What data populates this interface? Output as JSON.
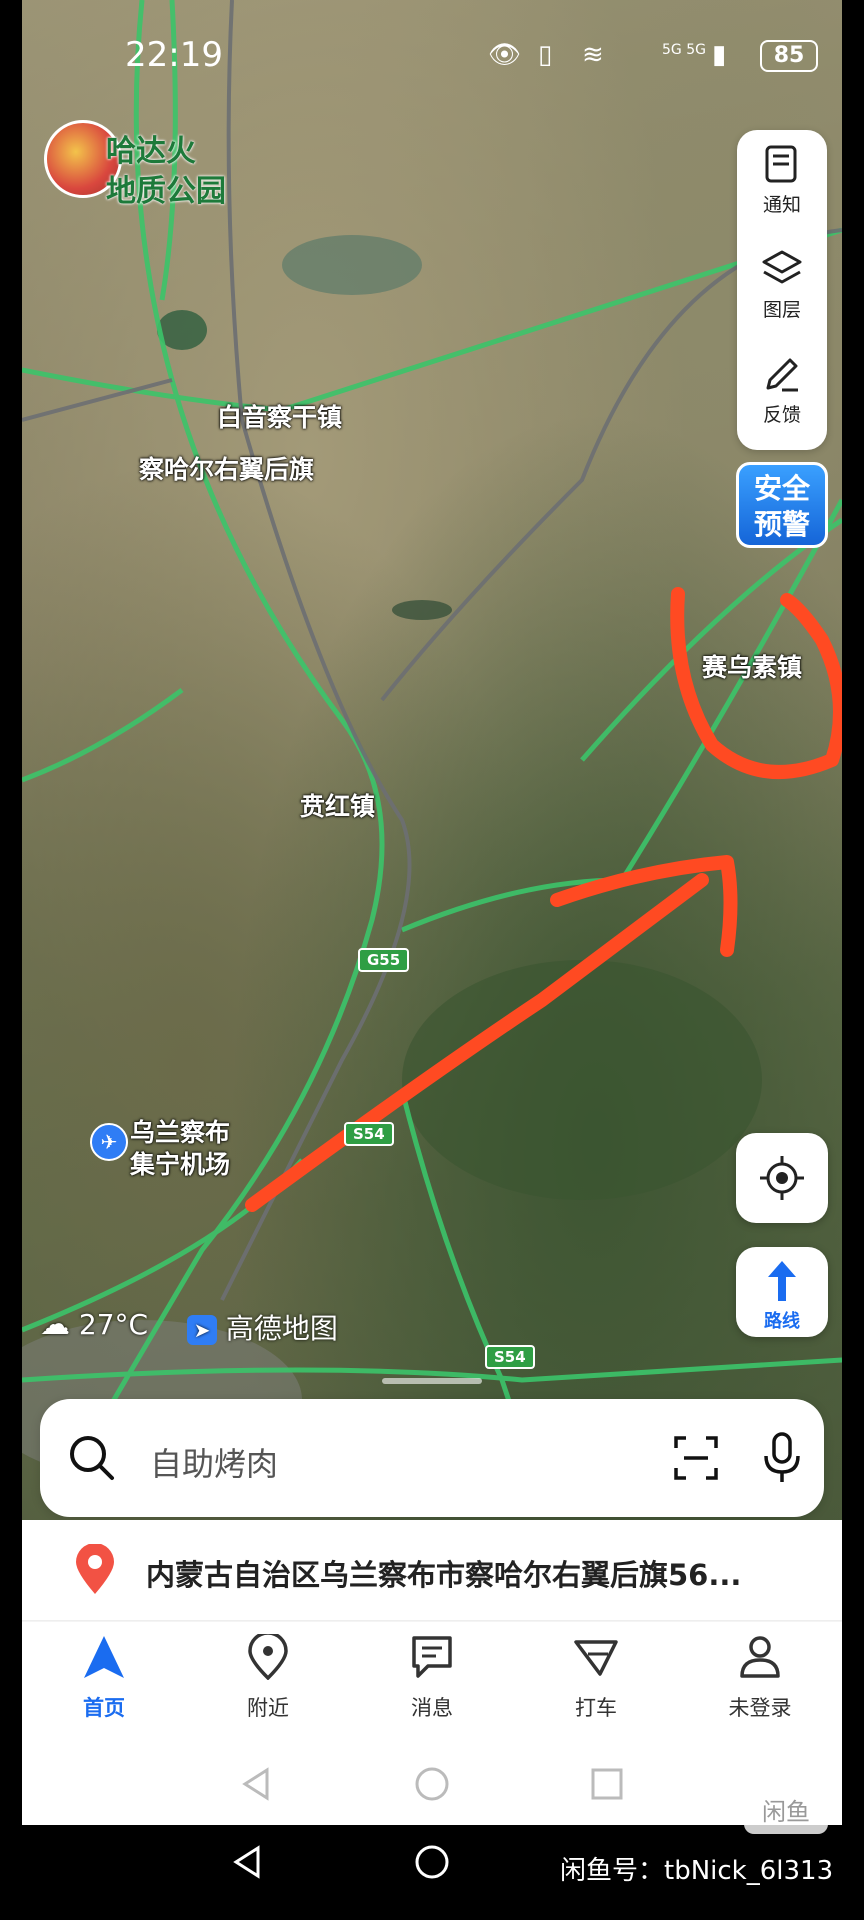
{
  "status_bar": {
    "time": "22:19",
    "network": "5G 5G",
    "battery": "85"
  },
  "map": {
    "park_label": [
      "哈达火",
      "地质公园"
    ],
    "places": {
      "town1": "白音察干镇",
      "town2": "察哈尔右翼后旗",
      "town3": "赛乌素镇",
      "town4": "贲红镇",
      "airport_line1": "乌兰察布",
      "airport_line2": "集宁机场"
    },
    "roads": {
      "g55": "G55",
      "s54a": "S54",
      "s54b": "S54"
    },
    "weather": "27°C",
    "brand": "高德地图"
  },
  "tools": {
    "notify": "通知",
    "layers": "图层",
    "feedback": "反馈"
  },
  "alert": {
    "line1": "安全",
    "line2": "预警"
  },
  "route_button": "路线",
  "search": {
    "placeholder": "自助烤肉"
  },
  "location": {
    "text": "内蒙古自治区乌兰察布市察哈尔右翼后旗56..."
  },
  "tabs": [
    {
      "label": "首页"
    },
    {
      "label": "附近"
    },
    {
      "label": "消息"
    },
    {
      "label": "打车"
    },
    {
      "label": "未登录"
    }
  ],
  "colors": {
    "accent": "#1a6cf0",
    "annotation": "#ff4a22",
    "road": "#3cc46a"
  },
  "watermark": "闲鱼号：tbNick_6l313",
  "wm_badge": "闲鱼"
}
